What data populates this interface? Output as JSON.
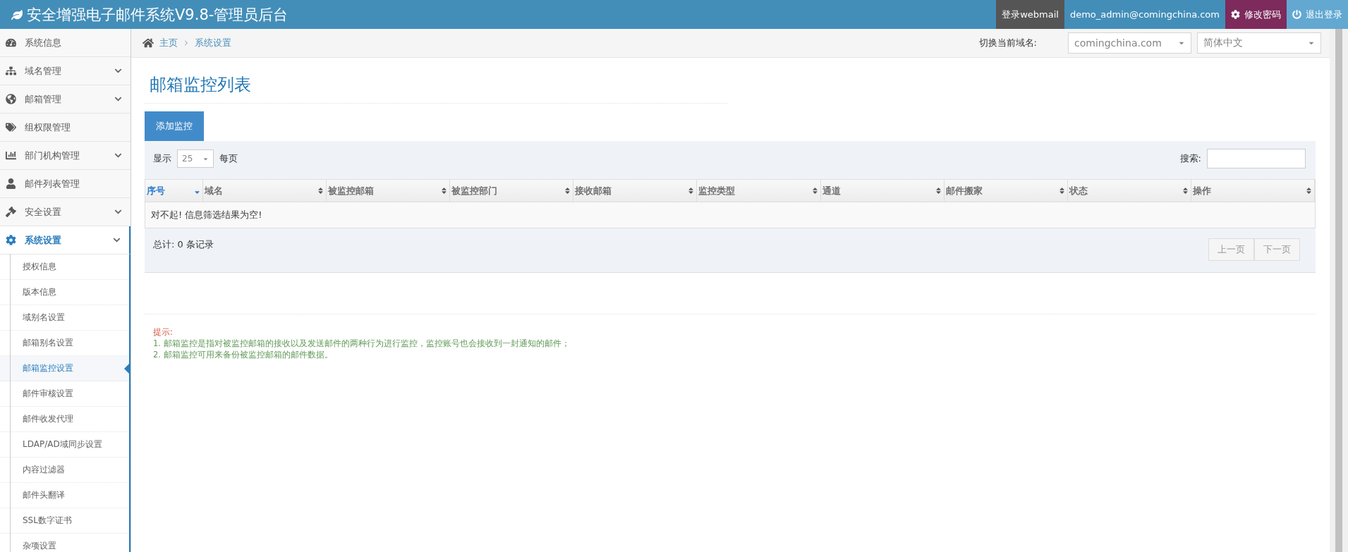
{
  "header": {
    "title": "安全增强电子邮件系统V9.8-管理员后台",
    "buttons": [
      {
        "kind": "webmail",
        "label": "登录webmail"
      },
      {
        "kind": "user",
        "label": "demo_admin@comingchina.com"
      },
      {
        "kind": "password",
        "label": "修改密码"
      },
      {
        "kind": "logout",
        "label": "退出登录"
      }
    ]
  },
  "sidebar": {
    "items": [
      {
        "label": "系统信息",
        "has_submenu": false,
        "selected": false
      },
      {
        "label": "域名管理",
        "has_submenu": true,
        "selected": false
      },
      {
        "label": "邮箱管理",
        "has_submenu": true,
        "selected": false
      },
      {
        "label": "组权限管理",
        "has_submenu": false,
        "selected": false
      },
      {
        "label": "部门机构管理",
        "has_submenu": true,
        "selected": false
      },
      {
        "label": "邮件列表管理",
        "has_submenu": false,
        "selected": false
      },
      {
        "label": "安全设置",
        "has_submenu": true,
        "selected": false
      },
      {
        "label": "系统设置",
        "has_submenu": true,
        "selected": true,
        "children": [
          {
            "label": "授权信息",
            "selected": false
          },
          {
            "label": "版本信息",
            "selected": false
          },
          {
            "label": "域别名设置",
            "selected": false
          },
          {
            "label": "邮箱别名设置",
            "selected": false
          },
          {
            "label": "邮箱监控设置",
            "selected": true
          },
          {
            "label": "邮件审核设置",
            "selected": false
          },
          {
            "label": "邮件收发代理",
            "selected": false
          },
          {
            "label": "LDAP/AD域同步设置",
            "selected": false
          },
          {
            "label": "内容过滤器",
            "selected": false
          },
          {
            "label": "邮件头翻译",
            "selected": false
          },
          {
            "label": "SSL数字证书",
            "selected": false
          },
          {
            "label": "杂项设置",
            "selected": false
          }
        ]
      }
    ]
  },
  "breadcrumb": [
    "主页",
    "系统设置"
  ],
  "domain_switch": {
    "label": "切换当前域名:",
    "domain": "comingchina.com",
    "language": "简体中文"
  },
  "page_title": "邮箱监控列表",
  "add_button": "添加监控",
  "table": {
    "show_label": "显示",
    "page_size": "25",
    "per_page_label": "每页",
    "search_label": "搜索:",
    "columns": [
      {
        "label": "序号",
        "selected": true
      },
      {
        "label": "域名",
        "selected": false
      },
      {
        "label": "被监控邮箱",
        "selected": false
      },
      {
        "label": "被监控部门",
        "selected": false
      },
      {
        "label": "接收邮箱",
        "selected": false
      },
      {
        "label": "监控类型",
        "selected": false
      },
      {
        "label": "通道",
        "selected": false
      },
      {
        "label": "邮件搬家",
        "selected": false
      },
      {
        "label": "状态",
        "selected": false
      },
      {
        "label": "操作",
        "selected": false
      }
    ],
    "empty_message": "对不起! 信息筛选结果为空!",
    "total": "总计: 0 条记录",
    "pager": [
      "上一页",
      "下一页"
    ]
  },
  "tips": {
    "title": "提示:",
    "lines": [
      "1. 邮箱监控是指对被监控邮箱的接收以及发送邮件的两种行为进行监控，监控账号也会接收到一封通知的邮件；",
      "2. 邮箱监控可用来备份被监控邮箱的邮件数据。"
    ]
  }
}
